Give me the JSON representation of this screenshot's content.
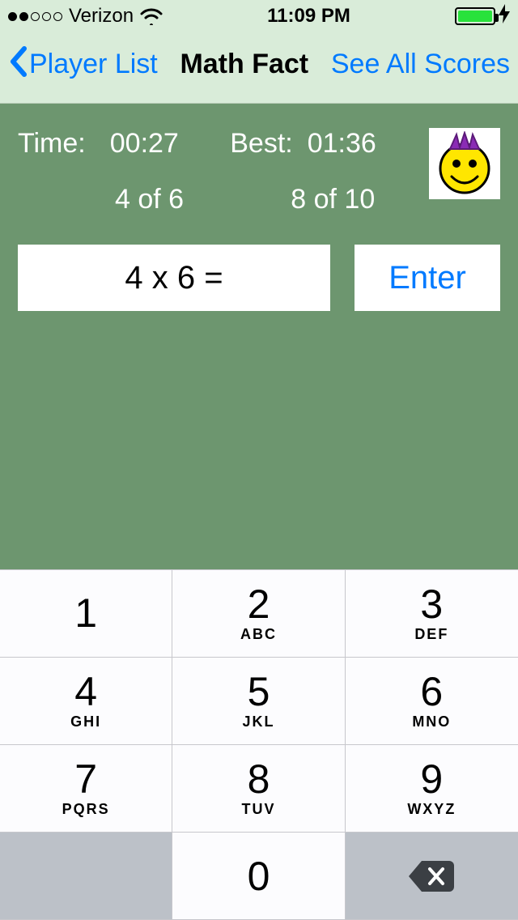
{
  "status_bar": {
    "carrier": "Verizon",
    "time": "11:09 PM"
  },
  "nav": {
    "back_label": "Player List",
    "title": "Math Fact",
    "right_label": "See All Scores"
  },
  "main": {
    "time_label": "Time:",
    "time_value": "00:27",
    "time_progress": "4 of 6",
    "best_label": "Best:",
    "best_value": "01:36",
    "best_progress": "8 of 10",
    "prompt": "4 x 6 =",
    "enter_label": "Enter"
  },
  "keypad": {
    "keys": [
      {
        "digit": "1",
        "letters": ""
      },
      {
        "digit": "2",
        "letters": "ABC"
      },
      {
        "digit": "3",
        "letters": "DEF"
      },
      {
        "digit": "4",
        "letters": "GHI"
      },
      {
        "digit": "5",
        "letters": "JKL"
      },
      {
        "digit": "6",
        "letters": "MNO"
      },
      {
        "digit": "7",
        "letters": "PQRS"
      },
      {
        "digit": "8",
        "letters": "TUV"
      },
      {
        "digit": "9",
        "letters": "WXYZ"
      },
      {
        "digit": "",
        "letters": ""
      },
      {
        "digit": "0",
        "letters": ""
      },
      {
        "digit": "",
        "letters": ""
      }
    ]
  }
}
